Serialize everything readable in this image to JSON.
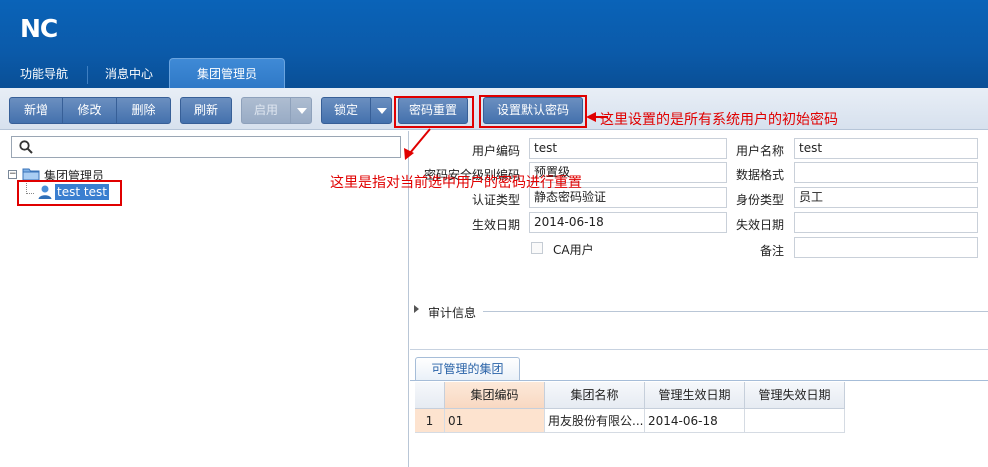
{
  "app": {
    "logo": "NC"
  },
  "top_tabs": [
    {
      "label": "功能导航"
    },
    {
      "label": "消息中心"
    },
    {
      "label": "集团管理员"
    }
  ],
  "toolbar": {
    "add": "新增",
    "edit": "修改",
    "delete": "删除",
    "refresh": "刷新",
    "enable": "启用",
    "lock": "锁定",
    "reset_password": "密码重置",
    "set_default_password": "设置默认密码"
  },
  "tree": {
    "root": "集团管理员",
    "user": "test test"
  },
  "form": {
    "user_code_label": "用户编码",
    "user_code": "test",
    "user_name_label": "用户名称",
    "user_name": "test",
    "pwd_level_label": "密码安全级别编码",
    "pwd_level": "预置级",
    "data_format_label": "数据格式",
    "data_format": "",
    "auth_type_label": "认证类型",
    "auth_type": "静态密码验证",
    "identity_type_label": "身份类型",
    "identity_type": "员工",
    "effective_date_label": "生效日期",
    "effective_date": "2014-06-18",
    "expire_date_label": "失效日期",
    "expire_date": "",
    "ca_user_label": "CA用户",
    "remark_label": "备注",
    "remark": ""
  },
  "audit": {
    "label": "审计信息"
  },
  "bottom_tab": {
    "label": "可管理的集团"
  },
  "grid": {
    "headers": [
      "集团编码",
      "集团名称",
      "管理生效日期",
      "管理失效日期"
    ],
    "rows": [
      {
        "num": "1",
        "code": "01",
        "name": "用友股份有限公...",
        "start": "2014-06-18",
        "end": ""
      }
    ]
  },
  "annotations": {
    "default_password_note": "这里设置的是所有系统用户的初始密码",
    "reset_note": "这里是指对当前选中用户的密码进行重置"
  },
  "colors": {
    "annotation": "#e00000",
    "header_blue": "#0b5aa9"
  }
}
